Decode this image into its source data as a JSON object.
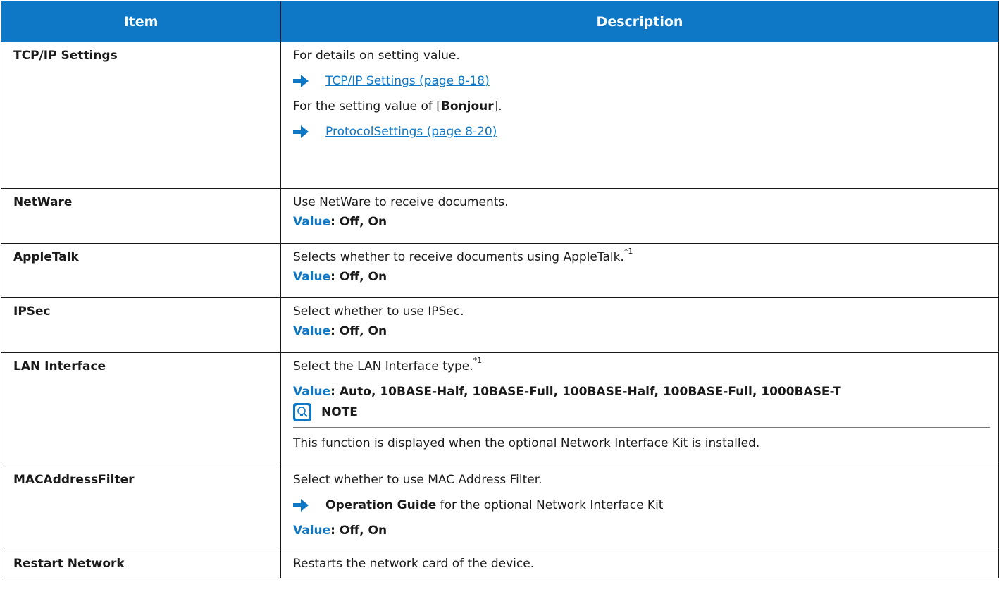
{
  "header": {
    "item": "Item",
    "description": "Description"
  },
  "rows": [
    {
      "item": "TCP/IP Settings",
      "desc1": "For details on setting value.",
      "link1": "TCP/IP Settings (page 8-18)",
      "desc2_pre": "For the setting value of [",
      "desc2_bold": "Bonjour",
      "desc2_post": "].",
      "link2": "ProtocolSettings (page 8-20)"
    },
    {
      "item": "NetWare",
      "desc": "Use NetWare to receive documents.",
      "value_label": "Value",
      "value": ": Off, On"
    },
    {
      "item": "AppleTalk",
      "desc": "Selects whether to receive documents using AppleTalk.",
      "footnote": "*1",
      "value_label": "Value",
      "value": ": Off, On"
    },
    {
      "item": "IPSec",
      "desc": "Select whether to use IPSec.",
      "value_label": "Value",
      "value": ": Off, On"
    },
    {
      "item": "LAN Interface",
      "desc": "Select the LAN Interface type.",
      "footnote": "*1",
      "value_label": "Value",
      "value": ": Auto, 10BASE-Half, 10BASE-Full, 100BASE-Half, 100BASE-Full, 1000BASE-T",
      "note_label": "NOTE",
      "note_text": "This function is displayed when the optional Network Interface Kit is installed."
    },
    {
      "item": "MACAddressFilter",
      "desc": "Select whether to use MAC Address Filter.",
      "ref_bold": "Operation Guide",
      "ref_rest": " for the optional Network Interface Kit",
      "value_label": "Value",
      "value": ": Off, On"
    },
    {
      "item": "Restart Network",
      "desc": "Restarts the network card of the device."
    }
  ],
  "colors": {
    "header_bg": "#0e78c6",
    "value_label": "#0e78c6",
    "link": "#0e78c6",
    "arrow": "#0e78c6"
  },
  "icons": {
    "arrow": "right-arrow-icon",
    "note": "lightbulb-note-icon"
  }
}
